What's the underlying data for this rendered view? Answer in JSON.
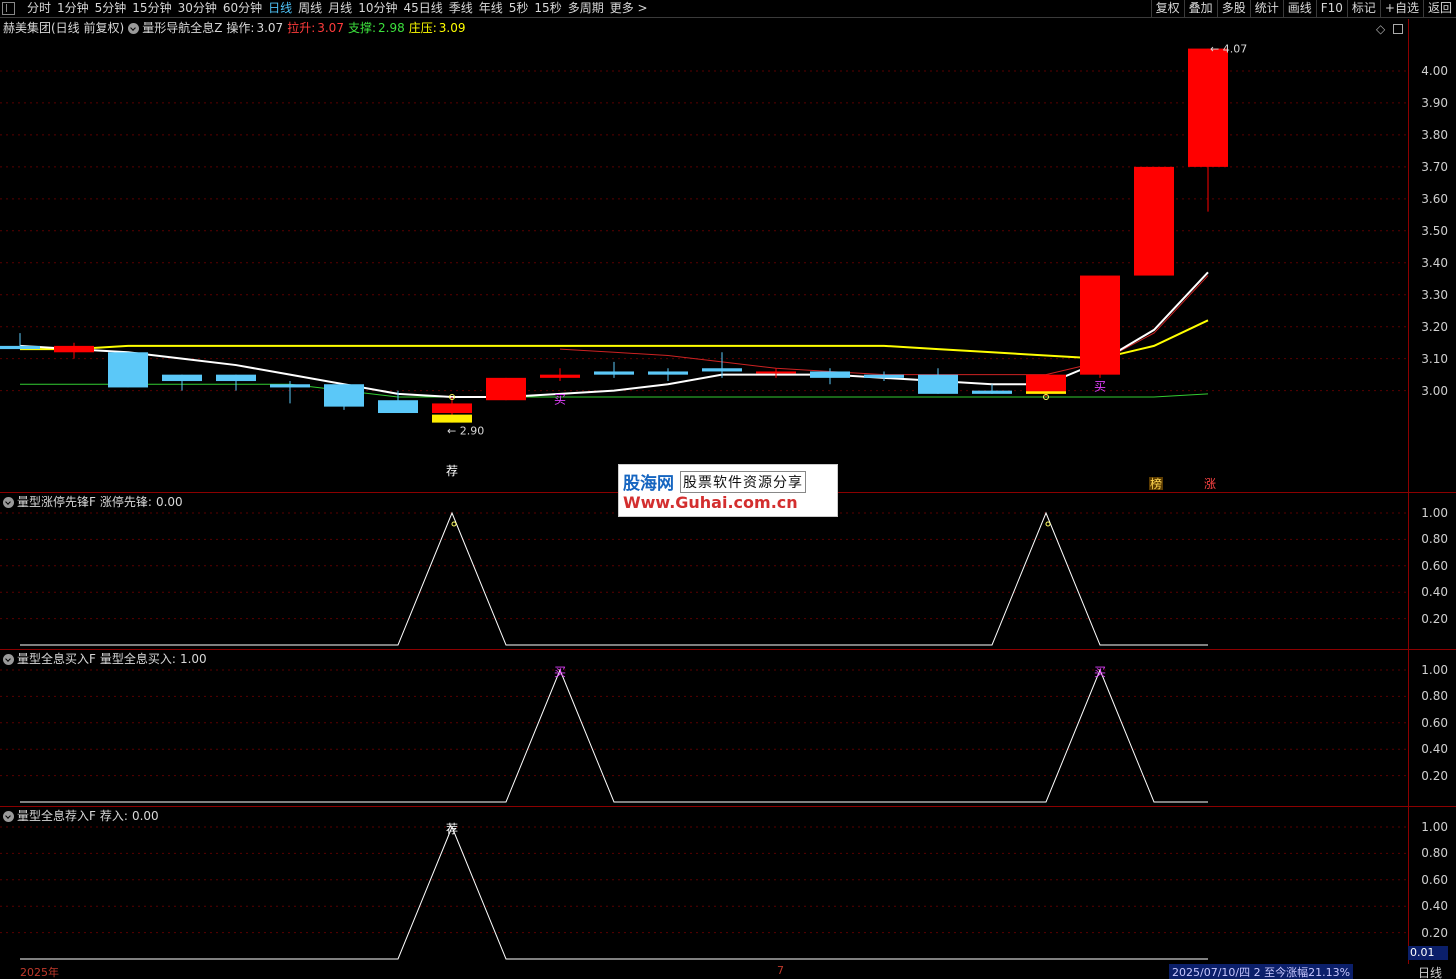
{
  "toolbar": {
    "tabs": [
      "分时",
      "1分钟",
      "5分钟",
      "15分钟",
      "30分钟",
      "60分钟",
      "日线",
      "周线",
      "月线",
      "10分钟",
      "45日线",
      "季线",
      "年线",
      "5秒",
      "15秒",
      "多周期",
      "更多 >"
    ],
    "active_tab": "日线",
    "right_buttons": [
      "复权",
      "叠加",
      "多股",
      "统计",
      "画线",
      "F10",
      "标记",
      "+自选",
      "返回"
    ]
  },
  "main_pane": {
    "stock": "赫美集团(日线 前复权)",
    "indicator": "量形导航全息Z",
    "op_label": "操作:",
    "op_value": "3.07",
    "lift_label": "拉升:",
    "lift_value": "3.07",
    "support_label": "支撑:",
    "support_value": "2.98",
    "pressure_label": "庄压:",
    "pressure_value": "3.09",
    "y_ticks": [
      "4.00",
      "3.90",
      "3.80",
      "3.70",
      "3.60",
      "3.50",
      "3.40",
      "3.30",
      "3.20",
      "3.10",
      "3.00"
    ],
    "high_label": "4.07",
    "low_label": "2.90",
    "buy_mark": "买",
    "recommend_mark": "荐",
    "rank_mark": "榜",
    "limit_mark": "涨",
    "colors": {
      "up": "#ff0000",
      "down": "#5bc8f8",
      "ma_white": "#ffffff",
      "ma_yellow": "#ffff00",
      "ma_green": "#32cd32",
      "ma_red": "#cc2222"
    }
  },
  "pane2": {
    "name": "量型涨停先锋F",
    "label": "涨停先锋:",
    "value": "0.00",
    "y_ticks": [
      "1.00",
      "0.80",
      "0.60",
      "0.40",
      "0.20"
    ]
  },
  "pane3": {
    "name": "量型全息买入F",
    "label": "量型全息买入:",
    "value": "1.00",
    "y_ticks": [
      "1.00",
      "0.80",
      "0.60",
      "0.40",
      "0.20"
    ],
    "mark": "买"
  },
  "pane4": {
    "name": "量型全息荐入F",
    "label": "荐入:",
    "value": "0.00",
    "y_ticks": [
      "1.00",
      "0.80",
      "0.60",
      "0.40",
      "0.20"
    ],
    "mark": "荐"
  },
  "watermark": {
    "logo": "股海网",
    "slogan": "股票软件资源分享",
    "url": "Www.Guhai.com.cn"
  },
  "bottom": {
    "year": "2025年",
    "month": "7",
    "status": "2025/07/10/四 2 至今涨幅21.13%",
    "cursor_value": "0.01",
    "period": "日线"
  },
  "chart_data": {
    "type": "candlestick",
    "ylim": [
      2.88,
      4.1
    ],
    "candles": [
      {
        "o": 3.14,
        "h": 3.18,
        "l": 3.13,
        "c": 3.13
      },
      {
        "o": 3.12,
        "h": 3.15,
        "l": 3.1,
        "c": 3.14
      },
      {
        "o": 3.12,
        "h": 3.12,
        "l": 3.01,
        "c": 3.01
      },
      {
        "o": 3.05,
        "h": 3.05,
        "l": 3.0,
        "c": 3.03
      },
      {
        "o": 3.05,
        "h": 3.05,
        "l": 3.0,
        "c": 3.03
      },
      {
        "o": 3.02,
        "h": 3.03,
        "l": 2.96,
        "c": 3.01
      },
      {
        "o": 3.02,
        "h": 3.02,
        "l": 2.94,
        "c": 2.95
      },
      {
        "o": 2.97,
        "h": 3.0,
        "l": 2.93,
        "c": 2.93
      },
      {
        "o": 2.93,
        "h": 2.98,
        "l": 2.9,
        "c": 2.96
      },
      {
        "o": 2.97,
        "h": 3.04,
        "l": 2.97,
        "c": 3.04
      },
      {
        "o": 3.04,
        "h": 3.07,
        "l": 3.03,
        "c": 3.05
      },
      {
        "o": 3.06,
        "h": 3.09,
        "l": 3.04,
        "c": 3.05
      },
      {
        "o": 3.06,
        "h": 3.07,
        "l": 3.03,
        "c": 3.05
      },
      {
        "o": 3.07,
        "h": 3.12,
        "l": 3.04,
        "c": 3.06
      },
      {
        "o": 3.06,
        "h": 3.07,
        "l": 3.04,
        "c": 3.06
      },
      {
        "o": 3.06,
        "h": 3.07,
        "l": 3.02,
        "c": 3.04
      },
      {
        "o": 3.05,
        "h": 3.06,
        "l": 3.03,
        "c": 3.04
      },
      {
        "o": 3.05,
        "h": 3.07,
        "l": 2.99,
        "c": 2.99
      },
      {
        "o": 3.0,
        "h": 3.02,
        "l": 2.99,
        "c": 2.99
      },
      {
        "o": 2.99,
        "h": 3.05,
        "l": 2.98,
        "c": 3.05
      },
      {
        "o": 3.05,
        "h": 3.36,
        "l": 3.04,
        "c": 3.36
      },
      {
        "o": 3.36,
        "h": 3.7,
        "l": 3.36,
        "c": 3.7
      },
      {
        "o": 3.7,
        "h": 4.07,
        "l": 3.56,
        "c": 4.07
      }
    ],
    "ma_white": [
      3.14,
      3.13,
      3.12,
      3.1,
      3.08,
      3.05,
      3.02,
      2.99,
      2.98,
      2.98,
      2.99,
      3.0,
      3.02,
      3.05,
      3.05,
      3.05,
      3.04,
      3.03,
      3.02,
      3.02,
      3.09,
      3.19,
      3.37
    ],
    "ma_yellow": [
      3.13,
      3.13,
      3.14,
      3.14,
      3.14,
      3.14,
      3.14,
      3.14,
      3.14,
      3.14,
      3.14,
      3.14,
      3.14,
      3.14,
      3.14,
      3.14,
      3.14,
      3.13,
      3.12,
      3.11,
      3.1,
      3.14,
      3.22
    ],
    "ma_green": [
      3.02,
      3.02,
      3.02,
      3.02,
      3.02,
      3.02,
      3.0,
      2.98,
      2.98,
      2.98,
      2.98,
      2.98,
      2.98,
      2.98,
      2.98,
      2.98,
      2.98,
      2.98,
      2.98,
      2.98,
      2.98,
      2.98,
      2.99
    ],
    "ma_red": [
      null,
      null,
      null,
      null,
      null,
      null,
      null,
      null,
      null,
      null,
      3.13,
      3.12,
      3.11,
      3.09,
      3.07,
      3.06,
      3.05,
      3.05,
      3.05,
      3.05,
      3.09,
      3.18,
      3.36
    ],
    "pane2_values": [
      0,
      0,
      0,
      0,
      0,
      0,
      0,
      0,
      1,
      0,
      0,
      0,
      0,
      0,
      0,
      0,
      0,
      0,
      0,
      1,
      0,
      0,
      0
    ],
    "pane3_values": [
      0,
      0,
      0,
      0,
      0,
      0,
      0,
      0,
      0,
      0,
      1,
      0,
      0,
      0,
      0,
      0,
      0,
      0,
      0,
      0,
      1,
      0,
      0
    ],
    "pane4_values": [
      0,
      0,
      0,
      0,
      0,
      0,
      0,
      0,
      1,
      0,
      0,
      0,
      0,
      0,
      0,
      0,
      0,
      0,
      0,
      0,
      0,
      0,
      0
    ]
  }
}
